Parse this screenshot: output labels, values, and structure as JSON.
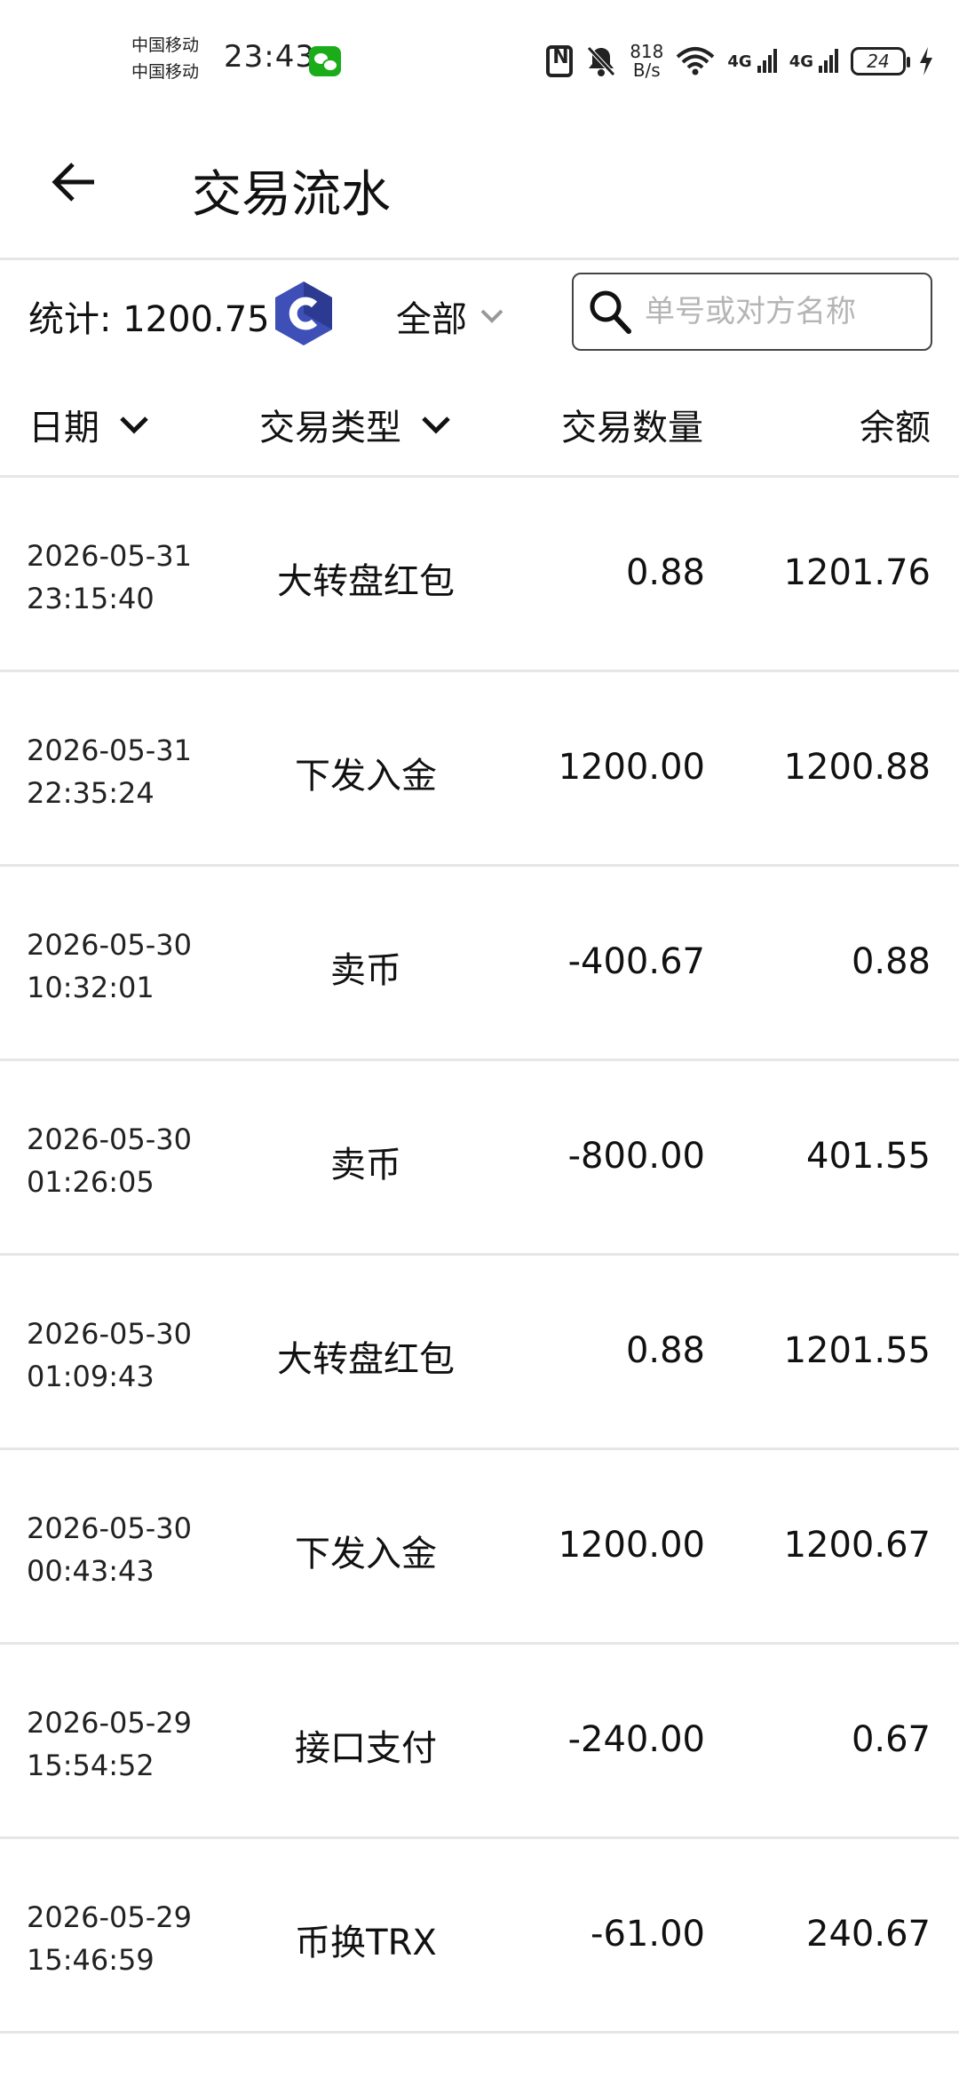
{
  "status_bar": {
    "carrier_1": "中国移动",
    "carrier_2": "中国移动",
    "time": "23:43",
    "net_speed_value": "818",
    "net_speed_unit": "B/s",
    "net_1": "4G",
    "net_2": "4G",
    "battery": "24"
  },
  "header": {
    "title": "交易流水"
  },
  "stats": {
    "label": "统计: 1200.75",
    "filter_label": "全部",
    "search_placeholder": "单号或对方名称",
    "search_value": ""
  },
  "columns": {
    "date": "日期",
    "type": "交易类型",
    "amount": "交易数量",
    "balance": "余额"
  },
  "rows": [
    {
      "date": "2026-05-31",
      "time": "23:15:40",
      "type": "大转盘红包",
      "amount": "0.88",
      "balance": "1201.76"
    },
    {
      "date": "2026-05-31",
      "time": "22:35:24",
      "type": "下发入金",
      "amount": "1200.00",
      "balance": "1200.88"
    },
    {
      "date": "2026-05-30",
      "time": "10:32:01",
      "type": "卖币",
      "amount": "-400.67",
      "balance": "0.88"
    },
    {
      "date": "2026-05-30",
      "time": "01:26:05",
      "type": "卖币",
      "amount": "-800.00",
      "balance": "401.55"
    },
    {
      "date": "2026-05-30",
      "time": "01:09:43",
      "type": "大转盘红包",
      "amount": "0.88",
      "balance": "1201.55"
    },
    {
      "date": "2026-05-30",
      "time": "00:43:43",
      "type": "下发入金",
      "amount": "1200.00",
      "balance": "1200.67"
    },
    {
      "date": "2026-05-29",
      "time": "15:54:52",
      "type": "接口支付",
      "amount": "-240.00",
      "balance": "0.67"
    },
    {
      "date": "2026-05-29",
      "time": "15:46:59",
      "type": "币换TRX",
      "amount": "-61.00",
      "balance": "240.67"
    }
  ],
  "colors": {
    "coin_primary": "#3f4fb8",
    "coin_dark": "#2c3a92",
    "divider": "#e6e6e6"
  },
  "icons": {
    "back": "arrow-left-icon",
    "coin": "coin-c-icon",
    "filter": "chevron-down-icon",
    "search": "search-icon"
  }
}
